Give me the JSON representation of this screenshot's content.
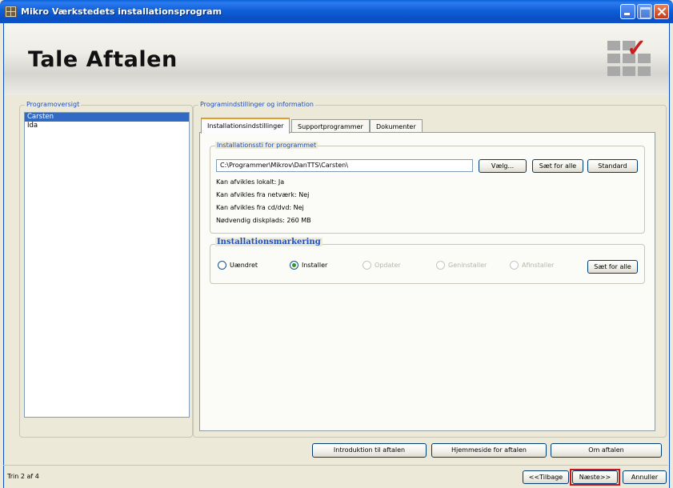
{
  "window": {
    "title": "Mikro Værkstedets installationsprogram"
  },
  "header": {
    "title": "Tale Aftalen"
  },
  "program_overview": {
    "legend": "Programoversigt",
    "items": [
      {
        "label": "Carsten",
        "selected": true
      },
      {
        "label": "Ida",
        "selected": false
      }
    ]
  },
  "settings": {
    "legend": "Programindstillinger og information",
    "tabs": [
      {
        "label": "Installationsindstillinger",
        "active": true
      },
      {
        "label": "Supportprogrammer",
        "active": false
      },
      {
        "label": "Dokumenter",
        "active": false
      }
    ],
    "install_path": {
      "legend": "Installationssti for programmet",
      "value": "C:\\Programmer\\Mikrov\\DanTTS\\Carsten\\",
      "browse_label": "Vælg...",
      "set_all_label": "Sæt for alle",
      "default_label": "Standard",
      "info": [
        "Kan afvikles lokalt: Ja",
        "Kan afvikles fra netværk: Nej",
        "Kan afvikles fra cd/dvd: Nej",
        "Nødvendig diskplads: 260 MB"
      ]
    },
    "marking": {
      "legend": "Installationsmarkering",
      "options": [
        {
          "label": "Uændret",
          "checked": false,
          "disabled": false
        },
        {
          "label": "Installer",
          "checked": true,
          "disabled": false
        },
        {
          "label": "Opdater",
          "checked": false,
          "disabled": true
        },
        {
          "label": "Geninstaller",
          "checked": false,
          "disabled": true
        },
        {
          "label": "Afinstaller",
          "checked": false,
          "disabled": true
        }
      ],
      "set_all_label": "Sæt for alle"
    }
  },
  "link_buttons": {
    "intro": "Introduktion til aftalen",
    "homepage": "Hjemmeside for aftalen",
    "about": "Om aftalen"
  },
  "footer": {
    "step_text": "Trin 2 af 4",
    "back_label": "<<Tilbage",
    "next_label": "Næste>>",
    "cancel_label": "Annuller"
  },
  "colors": {
    "titlebar": "#0a4fc4",
    "selection": "#316ac5",
    "legend_text": "#1c4fbf",
    "next_highlight": "#c8161d",
    "logo_check": "#c81e1e"
  }
}
